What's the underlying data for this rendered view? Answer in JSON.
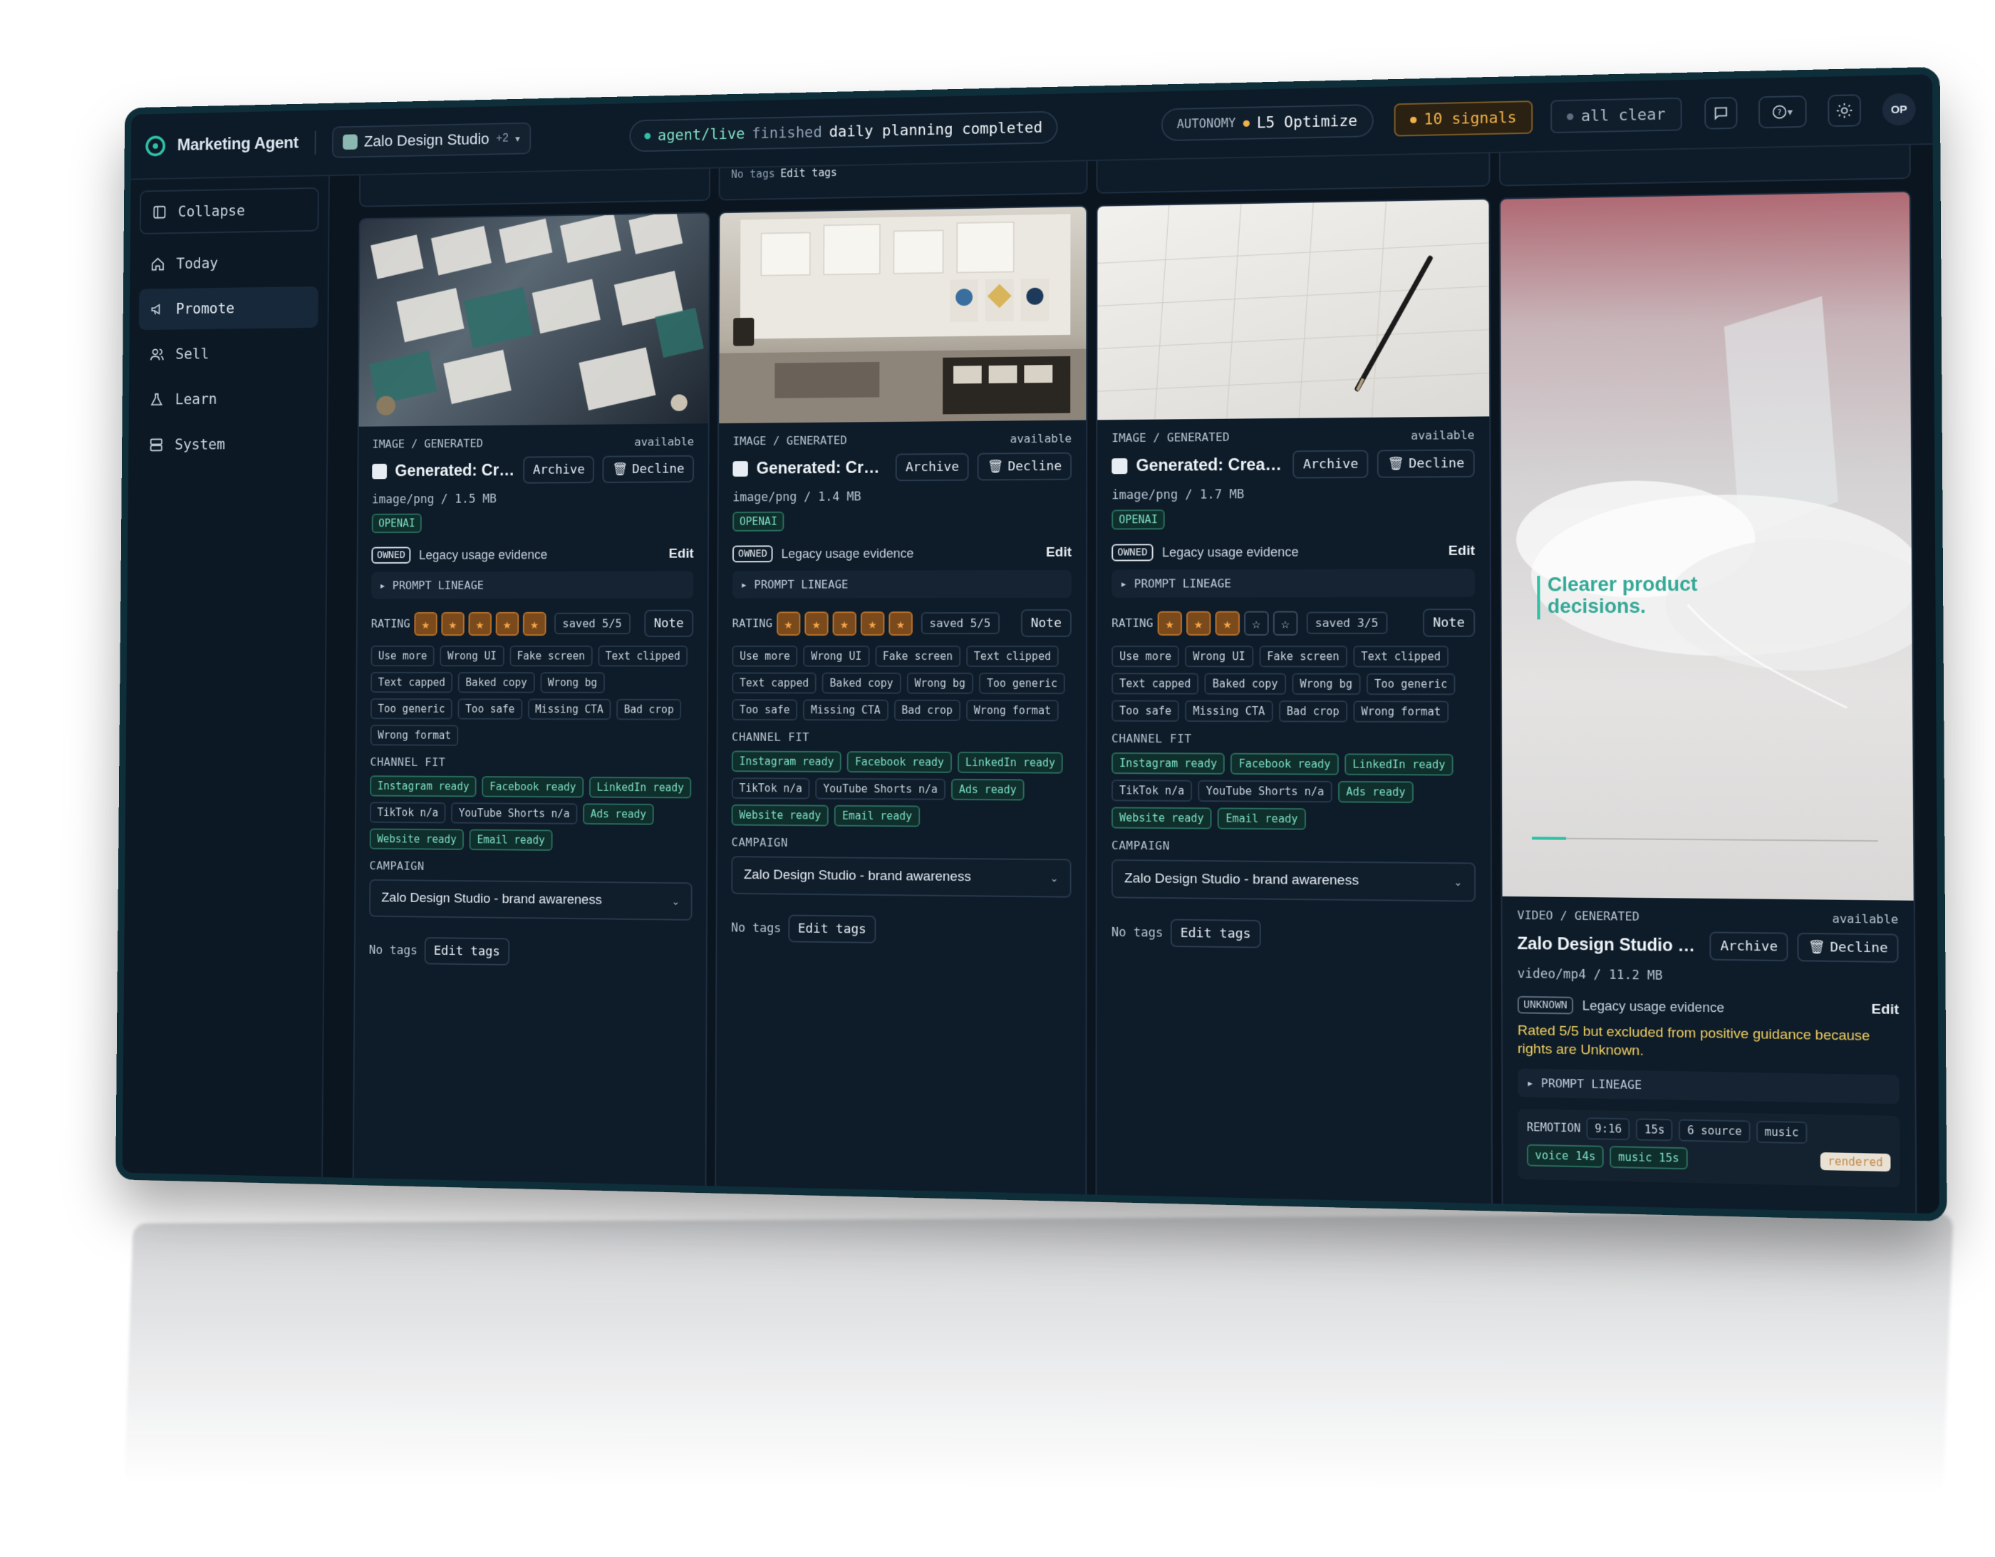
{
  "topbar": {
    "app_name": "Marketing Agent",
    "workspace_name": "Zalo Design Studio",
    "workspace_extra": "+2",
    "status_prefix": "agent/live",
    "status_mid": "finished",
    "status_text": "daily planning completed",
    "autonomy_label": "AUTONOMY",
    "autonomy_level": "L5 Optimize",
    "signals": "10 signals",
    "all_clear": "all clear",
    "avatar_initials": "OP"
  },
  "sidebar": {
    "items": [
      {
        "label": "Collapse",
        "icon": "collapse-icon"
      },
      {
        "label": "Today",
        "icon": "home-icon"
      },
      {
        "label": "Promote",
        "icon": "megaphone-icon"
      },
      {
        "label": "Sell",
        "icon": "users-icon"
      },
      {
        "label": "Learn",
        "icon": "flask-icon"
      },
      {
        "label": "System",
        "icon": "server-icon"
      }
    ]
  },
  "previous_row": {
    "no_tags": "No tags",
    "edit_tags": "Edit tags"
  },
  "cards": [
    {
      "kind": "IMAGE / GENERATED",
      "status": "available",
      "title": "Generated: Creati...",
      "archive": "Archive",
      "decline": "Decline",
      "meta": "image/png / 1.5 MB",
      "provider": "OPENAI",
      "rights": "OWNED",
      "evidence": "Legacy usage evidence",
      "edit": "Edit",
      "lineage": "PROMPT LINEAGE",
      "rating_label": "RATING",
      "rating": 5,
      "rating_max": 5,
      "saved": "saved 5/5",
      "note": "Note",
      "feedback": [
        "Use more",
        "Wrong UI",
        "Fake screen",
        "Text clipped",
        "Text capped",
        "Baked copy",
        "Wrong bg",
        "Too generic",
        "Too safe",
        "Missing CTA",
        "Bad crop",
        "Wrong format"
      ],
      "channel_label": "CHANNEL FIT",
      "channels": [
        {
          "label": "Instagram ready",
          "ready": true
        },
        {
          "label": "Facebook ready",
          "ready": true
        },
        {
          "label": "LinkedIn ready",
          "ready": true
        },
        {
          "label": "TikTok n/a",
          "ready": false
        },
        {
          "label": "YouTube Shorts n/a",
          "ready": false
        },
        {
          "label": "Ads ready",
          "ready": true
        },
        {
          "label": "Website ready",
          "ready": true
        },
        {
          "label": "Email ready",
          "ready": true
        }
      ],
      "campaign_label": "CAMPAIGN",
      "campaign": "Zalo Design Studio - brand awareness",
      "no_tags": "No tags",
      "edit_tags": "Edit tags"
    },
    {
      "kind": "IMAGE / GENERATED",
      "status": "available",
      "title": "Generated: Creati...",
      "archive": "Archive",
      "decline": "Decline",
      "meta": "image/png / 1.4 MB",
      "provider": "OPENAI",
      "rights": "OWNED",
      "evidence": "Legacy usage evidence",
      "edit": "Edit",
      "lineage": "PROMPT LINEAGE",
      "rating_label": "RATING",
      "rating": 5,
      "rating_max": 5,
      "saved": "saved 5/5",
      "note": "Note",
      "feedback": [
        "Use more",
        "Wrong UI",
        "Fake screen",
        "Text clipped",
        "Text capped",
        "Baked copy",
        "Wrong bg",
        "Too generic",
        "Too safe",
        "Missing CTA",
        "Bad crop",
        "Wrong format"
      ],
      "channel_label": "CHANNEL FIT",
      "channels": [
        {
          "label": "Instagram ready",
          "ready": true
        },
        {
          "label": "Facebook ready",
          "ready": true
        },
        {
          "label": "LinkedIn ready",
          "ready": true
        },
        {
          "label": "TikTok n/a",
          "ready": false
        },
        {
          "label": "YouTube Shorts n/a",
          "ready": false
        },
        {
          "label": "Ads ready",
          "ready": true
        },
        {
          "label": "Website ready",
          "ready": true
        },
        {
          "label": "Email ready",
          "ready": true
        }
      ],
      "campaign_label": "CAMPAIGN",
      "campaign": "Zalo Design Studio - brand awareness",
      "no_tags": "No tags",
      "edit_tags": "Edit tags"
    },
    {
      "kind": "IMAGE / GENERATED",
      "status": "available",
      "title": "Generated: Creati...",
      "archive": "Archive",
      "decline": "Decline",
      "meta": "image/png / 1.7 MB",
      "provider": "OPENAI",
      "rights": "OWNED",
      "evidence": "Legacy usage evidence",
      "edit": "Edit",
      "lineage": "PROMPT LINEAGE",
      "rating_label": "RATING",
      "rating": 3,
      "rating_max": 5,
      "saved": "saved 3/5",
      "note": "Note",
      "feedback": [
        "Use more",
        "Wrong UI",
        "Fake screen",
        "Text clipped",
        "Text capped",
        "Baked copy",
        "Wrong bg",
        "Too generic",
        "Too safe",
        "Missing CTA",
        "Bad crop",
        "Wrong format"
      ],
      "channel_label": "CHANNEL FIT",
      "channels": [
        {
          "label": "Instagram ready",
          "ready": true
        },
        {
          "label": "Facebook ready",
          "ready": true
        },
        {
          "label": "LinkedIn ready",
          "ready": true
        },
        {
          "label": "TikTok n/a",
          "ready": false
        },
        {
          "label": "YouTube Shorts n/a",
          "ready": false
        },
        {
          "label": "Ads ready",
          "ready": true
        },
        {
          "label": "Website ready",
          "ready": true
        },
        {
          "label": "Email ready",
          "ready": true
        }
      ],
      "campaign_label": "CAMPAIGN",
      "campaign": "Zalo Design Studio - brand awareness",
      "no_tags": "No tags",
      "edit_tags": "Edit tags"
    }
  ],
  "video_card": {
    "kind": "VIDEO / GENERATED",
    "status": "available",
    "title": "Zalo Design Studio pr...",
    "archive": "Archive",
    "decline": "Decline",
    "meta": "video/mp4 / 11.2 MB",
    "thumb_caption": "Clearer product decisions.",
    "rights": "UNKNOWN",
    "evidence": "Legacy usage evidence",
    "edit": "Edit",
    "warning": "Rated 5/5 but excluded from positive guidance because rights are Unknown.",
    "lineage": "PROMPT LINEAGE",
    "remotion_label": "REMOTION",
    "remotion_chips": [
      "9:16",
      "15s",
      "6 source",
      "music"
    ],
    "audio_chips": [
      "voice 14s",
      "music 15s"
    ],
    "rendered": "rendered"
  },
  "colors": {
    "accent": "#2fc1a6",
    "star": "#f0a54a",
    "warning": "#f0d060",
    "signals": "#f0b24a"
  }
}
